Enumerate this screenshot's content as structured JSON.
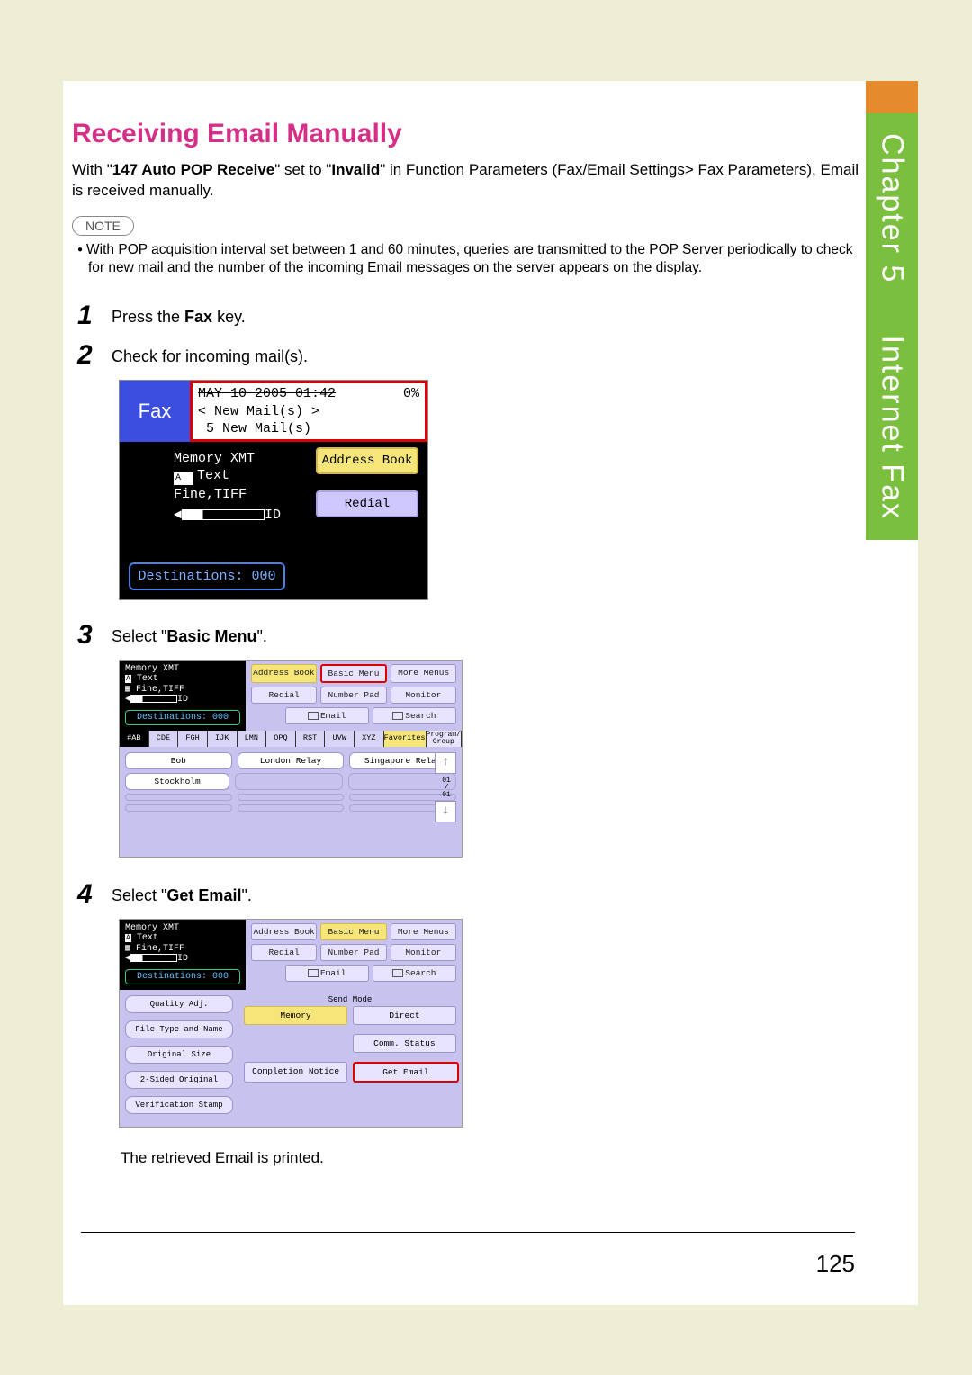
{
  "chapter_label": "Chapter 5",
  "chapter_title": "Internet Fax",
  "page_number": "125",
  "heading": "Receiving Email Manually",
  "intro_pre": "With \"",
  "intro_b1": "147 Auto POP Receive",
  "intro_mid1": "\" set to \"",
  "intro_b2": "Invalid",
  "intro_post": "\" in Function Parameters (Fax/Email Settings> Fax Parameters), Email is received manually.",
  "note_label": "NOTE",
  "note_text": "With POP acquisition interval set between 1 and 60 minutes, queries are transmitted to the POP Server periodically to check for new mail and the number of the incoming Email messages on the server appears on the display.",
  "steps": {
    "s1": {
      "num": "1",
      "pre": "Press the ",
      "bold": "Fax",
      "post": " key."
    },
    "s2": {
      "num": "2",
      "text": "Check for incoming mail(s)."
    },
    "s3": {
      "num": "3",
      "pre": "Select \"",
      "bold": "Basic Menu",
      "post": "\"."
    },
    "s4": {
      "num": "4",
      "pre": "Select \"",
      "bold": "Get Email",
      "post": "\"."
    }
  },
  "screen1": {
    "fax": "Fax",
    "date": "MAY 10 2005   01:42",
    "pct": "0%",
    "newmail1": "< New Mail(s) >",
    "newmail2": "5 New Mail(s)",
    "memory_xmt": "Memory XMT",
    "text_mode": "Text",
    "fine": "Fine,TIFF",
    "id": "ID",
    "address_book": "Address Book",
    "redial": "Redial",
    "destinations": "Destinations: 000"
  },
  "screen2": {
    "memory_xmt": "Memory XMT",
    "text_mode": "Text",
    "fine": "Fine,TIFF",
    "id": "ID",
    "destinations": "Destinations: 000",
    "address_book": "Address Book",
    "basic_menu": "Basic Menu",
    "more_menus": "More Menus",
    "redial": "Redial",
    "number_pad": "Number Pad",
    "monitor": "Monitor",
    "email": "Email",
    "search": "Search",
    "tabs": [
      "#AB",
      "CDE",
      "FGH",
      "IJK",
      "LMN",
      "OPQ",
      "RST",
      "UVW",
      "XYZ"
    ],
    "favorites": "Favorites",
    "program_group": "Program/\nGroup",
    "dest1": "Bob",
    "dest2": "London Relay",
    "dest3": "Singapore Relay",
    "dest4": "Stockholm",
    "page_ind": "01\n/\n01"
  },
  "screen3": {
    "memory_xmt": "Memory XMT",
    "text_mode": "Text",
    "fine": "Fine,TIFF",
    "id": "ID",
    "destinations": "Destinations: 000",
    "address_book": "Address Book",
    "basic_menu": "Basic Menu",
    "more_menus": "More Menus",
    "redial": "Redial",
    "number_pad": "Number Pad",
    "monitor": "Monitor",
    "email": "Email",
    "search": "Search",
    "send_mode": "Send Mode",
    "memory": "Memory",
    "direct": "Direct",
    "comm_status": "Comm. Status",
    "completion_notice": "Completion Notice",
    "get_email": "Get Email",
    "quality_adj": "Quality Adj.",
    "file_type": "File Type and Name",
    "original_size": "Original Size",
    "two_sided": "2-Sided Original",
    "verification_stamp": "Verification Stamp"
  },
  "retrieved": "The retrieved Email is printed."
}
